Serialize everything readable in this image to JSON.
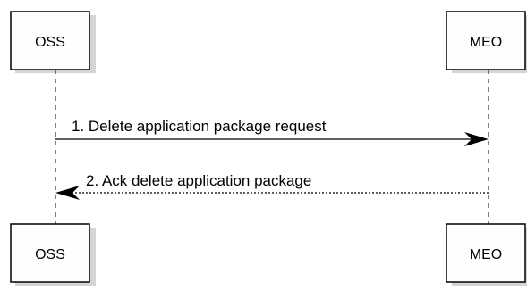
{
  "participants": {
    "oss": {
      "label": "OSS"
    },
    "meo": {
      "label": "MEO"
    }
  },
  "messages": [
    {
      "label": "1. Delete application package request",
      "from": "OSS",
      "to": "MEO",
      "style": "solid"
    },
    {
      "label": "2. Ack delete application package",
      "from": "MEO",
      "to": "OSS",
      "style": "dashed"
    }
  ],
  "colors": {
    "box_fill": "#fefefe",
    "line": "#000000"
  }
}
